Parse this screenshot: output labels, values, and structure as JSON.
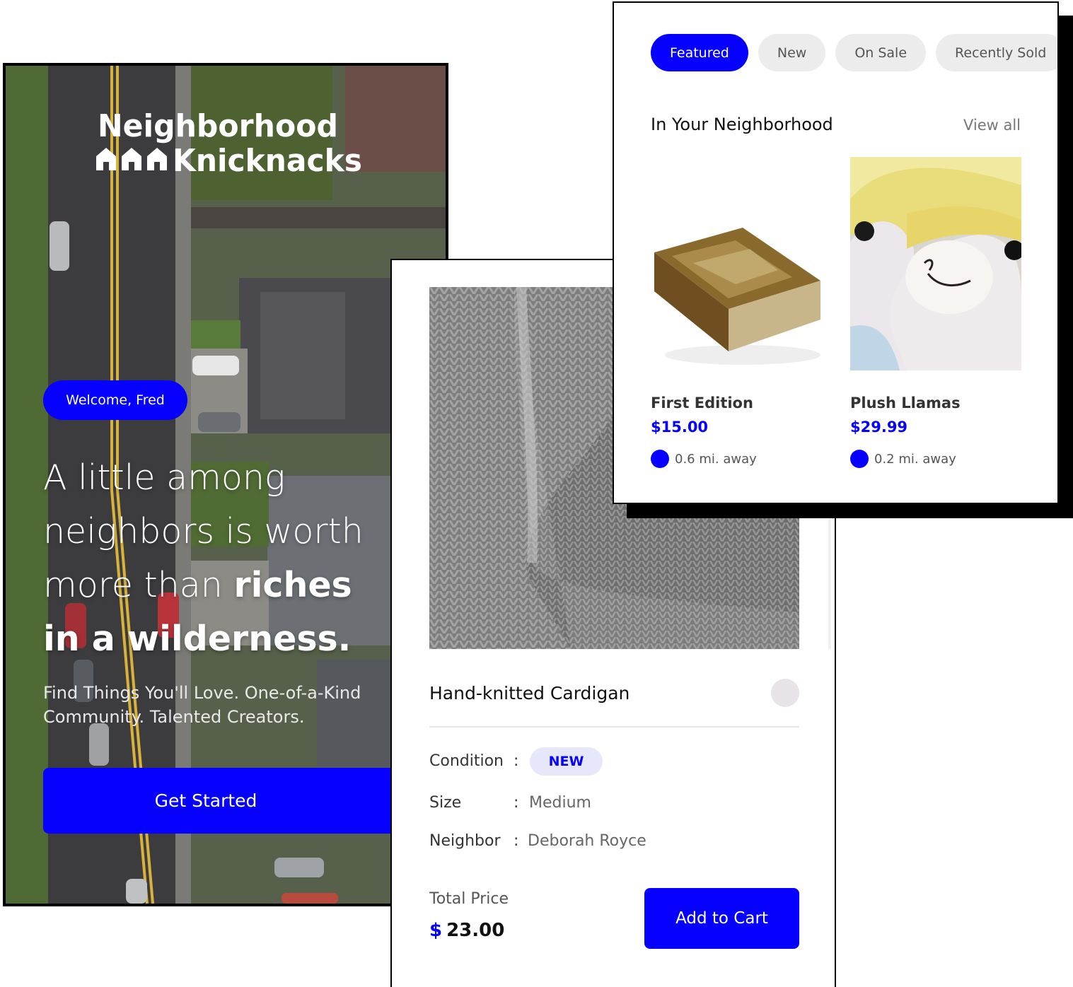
{
  "landing": {
    "logo_line1": "Neighborhood",
    "logo_line2": "Knicknacks",
    "welcome": "Welcome, Fred",
    "headline_light_1": "A little among",
    "headline_light_2": "neighbors is worth",
    "headline_light_3": "more than ",
    "headline_bold_3": "riches",
    "headline_bold_4": "in a wilderness.",
    "subtext": "Find Things You'll Love. One-of-a-Kind Community. Talented Creators.",
    "cta": "Get Started"
  },
  "detail": {
    "title": "Hand-knitted Cardigan",
    "specs": {
      "condition_label": "Condition",
      "condition_value": "NEW",
      "size_label": "Size",
      "size_value": "Medium",
      "neighbor_label": "Neighbor",
      "neighbor_value": "Deborah Royce",
      "colon": ":"
    },
    "total_label": "Total Price",
    "currency": "$",
    "total_value": "23.00",
    "add_to_cart": "Add to Cart"
  },
  "browse": {
    "tabs": [
      "Featured",
      "New",
      "On Sale",
      "Recently Sold"
    ],
    "active_tab": "Featured",
    "section_title": "In Your Neighborhood",
    "view_all": "View all",
    "items": [
      {
        "name": "First Edition",
        "price": "$15.00",
        "distance": "0.6 mi. away"
      },
      {
        "name": "Plush Llamas",
        "price": "$29.99",
        "distance": "0.2 mi. away"
      }
    ]
  },
  "colors": {
    "accent": "#0500ff",
    "chip_bg": "#ececec",
    "badge_bg": "#e7e7fb"
  },
  "icons": {
    "logo_houses": "three-houses-icon",
    "favorite": "favorite-dot-icon",
    "distance": "location-dot-icon"
  }
}
